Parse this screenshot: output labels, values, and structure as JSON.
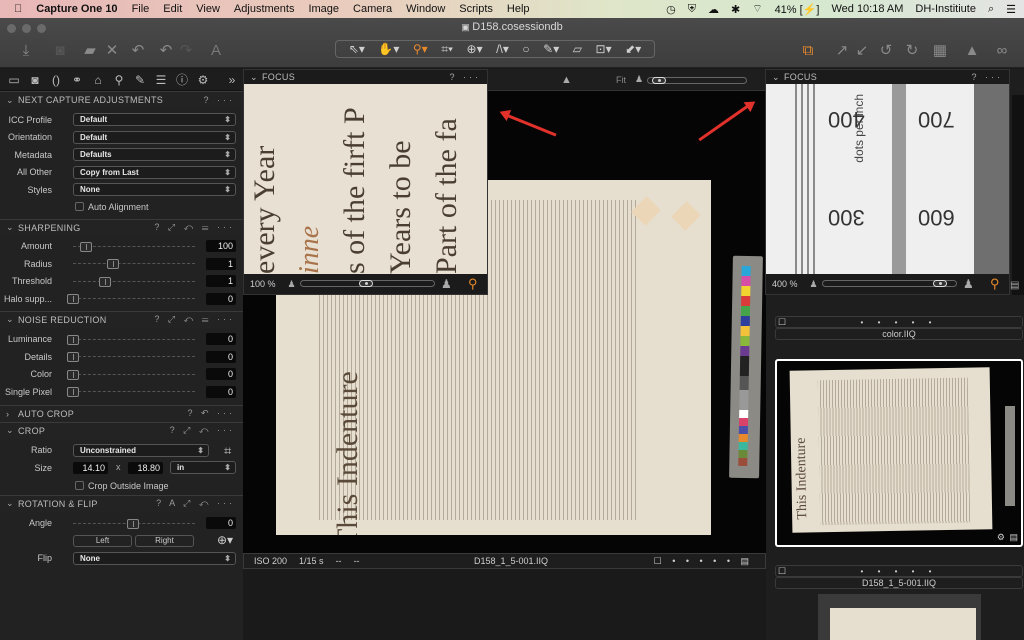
{
  "menubar": {
    "app_name": "Capture One 10",
    "items": [
      "File",
      "Edit",
      "View",
      "Adjustments",
      "Image",
      "Camera",
      "Window",
      "Scripts",
      "Help"
    ],
    "battery": "41%",
    "clock": "Wed 10:18 AM",
    "user": "DH-Institiute"
  },
  "window": {
    "title": "D158.cosessiondb"
  },
  "toolbar": {
    "left_tools": [
      "import-icon",
      "capture-icon",
      "move-to-icon",
      "delete-icon",
      "undo-all-icon",
      "undo-icon",
      "redo-icon",
      "auto-adjust-icon"
    ],
    "cursor_tools": [
      "select",
      "pan",
      "zoom",
      "crop",
      "rotate",
      "keystone",
      "spot-removal",
      "brush",
      "straighten",
      "color-picker",
      "copy-adjustments"
    ],
    "right_tools": [
      "multi-view",
      "copy",
      "apply",
      "rotate-left",
      "rotate-right",
      "grid",
      "exposure-warning",
      "proof"
    ]
  },
  "left_panel": {
    "tabs": [
      "library",
      "capture",
      "lens",
      "color",
      "exposure",
      "details",
      "adjustments",
      "metadata",
      "output",
      "settings"
    ],
    "next_capture": {
      "title": "NEXT CAPTURE ADJUSTMENTS",
      "rows": [
        {
          "label": "ICC Profile",
          "value": "Default"
        },
        {
          "label": "Orientation",
          "value": "Default"
        },
        {
          "label": "Metadata",
          "value": "Defaults"
        },
        {
          "label": "All Other",
          "value": "Copy from Last"
        },
        {
          "label": "Styles",
          "value": "None"
        }
      ],
      "auto_alignment": "Auto Alignment"
    },
    "sharpening": {
      "title": "SHARPENING",
      "rows": [
        {
          "label": "Amount",
          "value": "100"
        },
        {
          "label": "Radius",
          "value": "1"
        },
        {
          "label": "Threshold",
          "value": "1"
        },
        {
          "label": "Halo supp...",
          "value": "0"
        }
      ]
    },
    "noise": {
      "title": "NOISE REDUCTION",
      "rows": [
        {
          "label": "Luminance",
          "value": "0"
        },
        {
          "label": "Details",
          "value": "0"
        },
        {
          "label": "Color",
          "value": "0"
        },
        {
          "label": "Single Pixel",
          "value": "0"
        }
      ]
    },
    "auto_crop": {
      "title": "AUTO CROP"
    },
    "crop": {
      "title": "CROP",
      "ratio_label": "Ratio",
      "ratio": "Unconstrained",
      "size_label": "Size",
      "width": "14.10",
      "x": "x",
      "height": "18.80",
      "unit": "in",
      "outside": "Crop Outside Image"
    },
    "rotation": {
      "title": "ROTATION & FLIP",
      "angle_label": "Angle",
      "angle": "0",
      "left": "Left",
      "right": "Right",
      "flip_label": "Flip",
      "flip": "None"
    }
  },
  "viewer": {
    "fit_label": "Fit",
    "status": {
      "iso": "ISO 200",
      "shutter": "1/15 s",
      "aperture": "--",
      "focal": "--",
      "filename": "D158_1_5-001.IIQ"
    },
    "document_heading": "This Indenture"
  },
  "focus_left": {
    "title": "FOCUS",
    "zoom": "100 %",
    "text_lines": [
      "every Year",
      "s of the firft P",
      "Years to be",
      "Part of the fa"
    ]
  },
  "focus_right": {
    "title": "FOCUS",
    "zoom": "400 %",
    "numbers": [
      "400",
      "700",
      "300",
      "600"
    ],
    "label": "dots per inch"
  },
  "browser": {
    "items": [
      {
        "name": "color.IIQ",
        "rating_dots": "• • • • •"
      },
      {
        "name": "D158_1_5-001.IIQ",
        "rating_dots": "• • • • •",
        "selected": true
      }
    ]
  },
  "colors": {
    "accent": "#e8892b",
    "arrow": "#e0312b",
    "panel": "#222222"
  }
}
